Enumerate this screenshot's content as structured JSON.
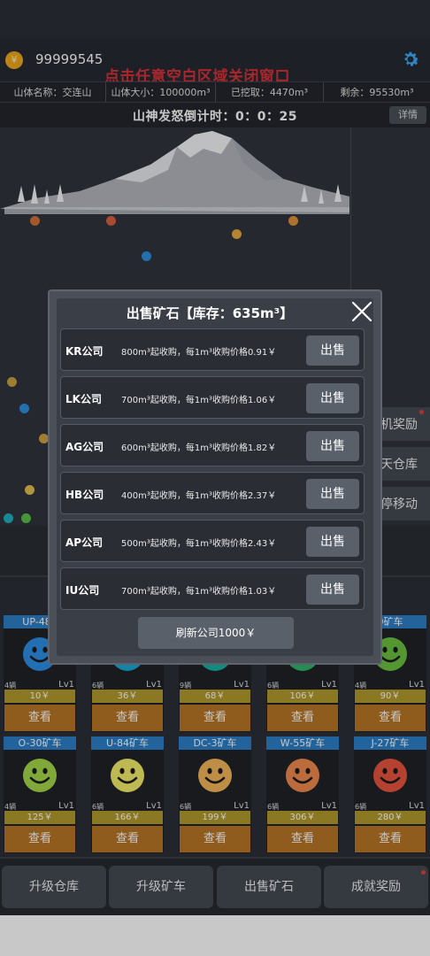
{
  "header": {
    "gold_icon": "¥",
    "gold": "99999545",
    "close_hint": "点击任意空白区域关闭窗口"
  },
  "info": {
    "mountain_name": "山体名称：交连山",
    "mountain_size": "山体大小：100000m³",
    "mined": "已挖取：4470m³",
    "remaining": "剩余：95530m³"
  },
  "countdown": "山神发怒倒计时：0：0：25",
  "detail_label": "详情",
  "side_buttons": [
    "机奖励",
    "天仓库",
    "停移动"
  ],
  "carts": [
    {
      "name": "UP-486",
      "count": "4辆",
      "lv": "Lv1",
      "price": "10￥",
      "view": "查看",
      "color": "#2d8fe6"
    },
    {
      "name": "",
      "count": "6辆",
      "lv": "Lv1",
      "price": "36￥",
      "view": "查看",
      "color": "#19a9d8"
    },
    {
      "name": "",
      "count": "9辆",
      "lv": "Lv1",
      "price": "68￥",
      "view": "查看",
      "color": "#17b3a4"
    },
    {
      "name": "",
      "count": "6辆",
      "lv": "Lv1",
      "price": "106￥",
      "view": "查看",
      "color": "#33b56c"
    },
    {
      "name": "0矿车",
      "count": "4辆",
      "lv": "Lv1",
      "price": "90￥",
      "view": "查看",
      "color": "#6cc140"
    },
    {
      "name": "O-30矿车",
      "count": "4辆",
      "lv": "Lv1",
      "price": "125￥",
      "view": "查看",
      "color": "#a6d94a"
    },
    {
      "name": "U-84矿车",
      "count": "6辆",
      "lv": "Lv1",
      "price": "166￥",
      "view": "查看",
      "color": "#f4ee6a"
    },
    {
      "name": "DC-3矿车",
      "count": "6辆",
      "lv": "Lv1",
      "price": "199￥",
      "view": "查看",
      "color": "#f5b65a"
    },
    {
      "name": "W-55矿车",
      "count": "6辆",
      "lv": "Lv1",
      "price": "306￥",
      "view": "查看",
      "color": "#f08a4e"
    },
    {
      "name": "J-27矿车",
      "count": "6辆",
      "lv": "Lv1",
      "price": "280￥",
      "view": "查看",
      "color": "#e8553e"
    }
  ],
  "bottom": [
    "升级仓库",
    "升级矿车",
    "出售矿石",
    "成就奖励"
  ],
  "modal": {
    "title": "出售矿石【库存：635m³】",
    "companies": [
      {
        "name": "KR公司",
        "desc": "800m³起收购，每1m³收购价格0.91￥",
        "sell": "出售"
      },
      {
        "name": "LK公司",
        "desc": "700m³起收购，每1m³收购价格1.06￥",
        "sell": "出售"
      },
      {
        "name": "AG公司",
        "desc": "600m³起收购，每1m³收购价格1.82￥",
        "sell": "出售"
      },
      {
        "name": "HB公司",
        "desc": "400m³起收购，每1m³收购价格2.37￥",
        "sell": "出售"
      },
      {
        "name": "AP公司",
        "desc": "500m³起收购，每1m³收购价格2.43￥",
        "sell": "出售"
      },
      {
        "name": "IU公司",
        "desc": "700m³起收购，每1m³收购价格1.03￥",
        "sell": "出售"
      }
    ],
    "refresh": "刷新公司1000￥"
  }
}
